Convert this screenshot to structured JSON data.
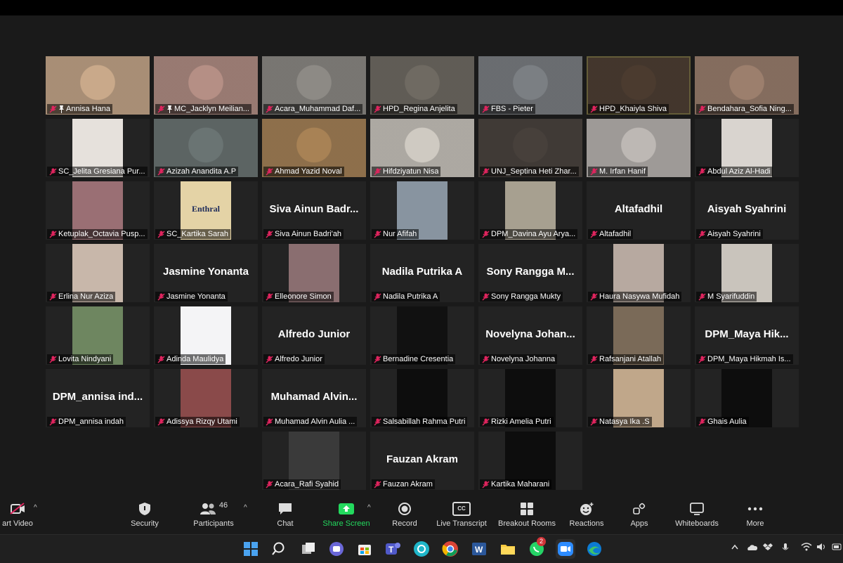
{
  "participants": [
    {
      "name": "Annisa Hana",
      "pinned": true,
      "photo": "#c9a98a"
    },
    {
      "name": "MC_Jacklyn Meilian...",
      "pinned": true,
      "photo": "#b58f85"
    },
    {
      "name": "Acara_Muhammad Daf...",
      "photo": "#8d8a85"
    },
    {
      "name": "HPD_Regina Anjelita",
      "photo": "#6f6a62"
    },
    {
      "name": "FBS - Pieter",
      "photo": "#7b7f83"
    },
    {
      "name": "HPD_Khaiyla Shiva",
      "photo": "#4b3b2f",
      "active": true
    },
    {
      "name": "Bendahara_Sofia Ning...",
      "photo": "#9c7f6d"
    },
    {
      "name": "SC_Jelita Gresiana Pur...",
      "photo_small": "#e6e1dc"
    },
    {
      "name": "Azizah Anandita A.P",
      "photo": "#6a7473"
    },
    {
      "name": "Ahmad Yazid Noval",
      "photo": "#a88255"
    },
    {
      "name": "Hifdziyatun Nisa",
      "photo": "#cfcac2"
    },
    {
      "name": "UNJ_Septina Heti Zhar...",
      "photo": "#47403b"
    },
    {
      "name": "M. Irfan Hanif",
      "photo": "#bdb8b4"
    },
    {
      "name": "Abdul Aziz Al-Hadi",
      "photo_small": "#d9d4cf"
    },
    {
      "name": "Ketuplak_Octavia Pusp...",
      "photo_small": "#9a6f74"
    },
    {
      "name": "SC_Kartika Sarah",
      "photo_small": "#e4d3a6",
      "poster_text": "Enthral"
    },
    {
      "name": "Siva Ainun Badri'ah",
      "big_name": "Siva Ainun Badr..."
    },
    {
      "name": "Nur Afifah",
      "photo_small": "#8894a0"
    },
    {
      "name": "DPM_Davina Ayu Arya...",
      "photo_small": "#a7a090"
    },
    {
      "name": "Altafadhil",
      "big_name": "Altafadhil"
    },
    {
      "name": "Aisyah Syahrini",
      "big_name": "Aisyah Syahrini"
    },
    {
      "name": "Erlina Nur Aziza",
      "photo_small": "#c8b7aa"
    },
    {
      "name": "Jasmine Yonanta",
      "big_name": "Jasmine Yonanta"
    },
    {
      "name": "Elleonore Simon",
      "photo_small": "#8a6e70"
    },
    {
      "name": "Nadila Putrika A",
      "big_name": "Nadila Putrika A"
    },
    {
      "name": "Sony Rangga Mukty",
      "big_name": "Sony Rangga M..."
    },
    {
      "name": "Haura Nasywa Mufidah",
      "photo_small": "#b7a9a0"
    },
    {
      "name": "M Syarifuddin",
      "photo_small": "#c9c4bc"
    },
    {
      "name": "Lovita Nindyani",
      "photo_small": "#6e8660"
    },
    {
      "name": "Adinda Maulidya",
      "photo_small": "#f4f4f6"
    },
    {
      "name": "Alfredo Junior",
      "big_name": "Alfredo Junior"
    },
    {
      "name": "Bernadine Cresentia",
      "photo_small": "#111111"
    },
    {
      "name": "Novelyna Johanna",
      "big_name": "Novelyna Johan..."
    },
    {
      "name": "Rafsanjani Atallah",
      "photo_small": "#7a6a58"
    },
    {
      "name": "DPM_Maya Hikmah Is...",
      "big_name": "DPM_Maya Hik..."
    },
    {
      "name": "DPM_annisa indah",
      "big_name": "DPM_annisa ind..."
    },
    {
      "name": "Adissya Rizqy Utami",
      "photo_small": "#8a4a4a"
    },
    {
      "name": "Muhamad Alvin Aulia ...",
      "big_name": "Muhamad Alvin..."
    },
    {
      "name": "Salsabillah Rahma Putri",
      "photo_small": "#0d0d0d"
    },
    {
      "name": "Rizki Amelia Putri",
      "photo_small": "#0d0d0d"
    },
    {
      "name": "Natasya Ika .S",
      "photo_small": "#c0a78a"
    },
    {
      "name": "Ghais Aulia",
      "photo_small": "#0d0d0d"
    },
    {
      "name": "Acara_Rafi Syahid",
      "photo_small": "#3a3a3a",
      "col": 3
    },
    {
      "name": "Fauzan Akram",
      "big_name": "Fauzan Akram"
    },
    {
      "name": "Kartika Maharani",
      "photo_small": "#0d0d0d"
    }
  ],
  "toolbar": {
    "start_video": "art Video",
    "security": "Security",
    "participants": "Participants",
    "participants_count": "46",
    "chat": "Chat",
    "share_screen": "Share Screen",
    "record": "Record",
    "live_transcript": "Live Transcript",
    "breakout_rooms": "Breakout Rooms",
    "reactions": "Reactions",
    "apps": "Apps",
    "whiteboards": "Whiteboards",
    "more": "More",
    "live_transcript_icon_text": "CC"
  },
  "taskbar": {
    "whatsapp_badge": "2",
    "apps": [
      "windows-start",
      "search",
      "task-view",
      "teams-chat",
      "store",
      "teams",
      "canva",
      "chrome",
      "word",
      "file-explorer",
      "whatsapp",
      "zoom",
      "edge"
    ]
  },
  "colors": {
    "share_green": "#23d95e",
    "active_border": "#c7e35a",
    "muted_red": "#e0245e"
  }
}
